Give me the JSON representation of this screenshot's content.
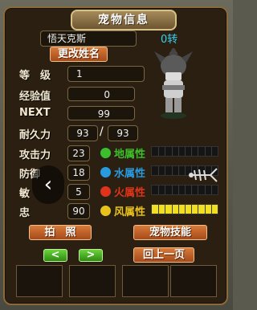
{
  "window": {
    "title": "宠物信息"
  },
  "pet": {
    "name": "悟天克斯",
    "rebirth": "0转",
    "rename_button": "更改姓名"
  },
  "stats": {
    "level_label": "等　级",
    "level": "1",
    "exp_label": "经验值",
    "exp": "0",
    "next_label": "NEXT",
    "next": "99",
    "durability_label": "耐久力",
    "durability_current": "93",
    "durability_sep": "/",
    "durability_max": "93",
    "attack_label": "攻击力",
    "attack": "23",
    "defense_label": "防御",
    "defense": "18",
    "agility_label": "敏",
    "agility": "5",
    "loyalty_label": "忠",
    "loyalty": "90"
  },
  "elements": [
    {
      "label": "地属性",
      "color": "#3dbf2a",
      "fill": 0
    },
    {
      "label": "水属性",
      "color": "#2a9adf",
      "fill": 0
    },
    {
      "label": "火属性",
      "color": "#e0331a",
      "fill": 0
    },
    {
      "label": "风属性",
      "color": "#e8c21a",
      "fill": 1.0
    }
  ],
  "buttons": {
    "photo": "拍　照",
    "skills": "宠物技能",
    "prev": "<",
    "next": ">",
    "back": "回上一页"
  },
  "overlay": {
    "prev_image": "‹"
  },
  "colors": {
    "panel": "#2b1f12",
    "accent": "#d77a3a",
    "wind_bar": "#f0e020"
  }
}
